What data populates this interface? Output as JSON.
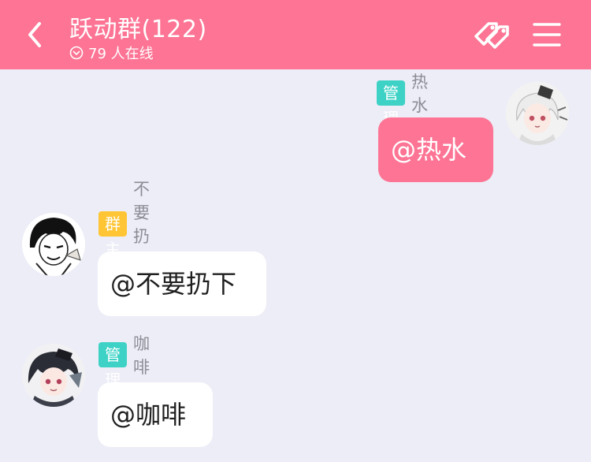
{
  "header": {
    "title": "跃动群(122)",
    "online": "79 人在线"
  },
  "messages": [
    {
      "side": "right",
      "role": "管理员",
      "nickname": "热水",
      "text": "@热水"
    },
    {
      "side": "left",
      "role": "群主",
      "nickname": "不要扔下",
      "text": "@不要扔下"
    },
    {
      "side": "left",
      "role": "管理员",
      "nickname": "咖啡",
      "text": "@咖啡"
    }
  ],
  "colors": {
    "header_bg": "#fd7494",
    "page_bg": "#ecedf6",
    "admin_badge": "#3ed2c6",
    "owner_badge": "#ffc534",
    "my_bubble": "#fd7494",
    "their_bubble": "#ffffff"
  }
}
